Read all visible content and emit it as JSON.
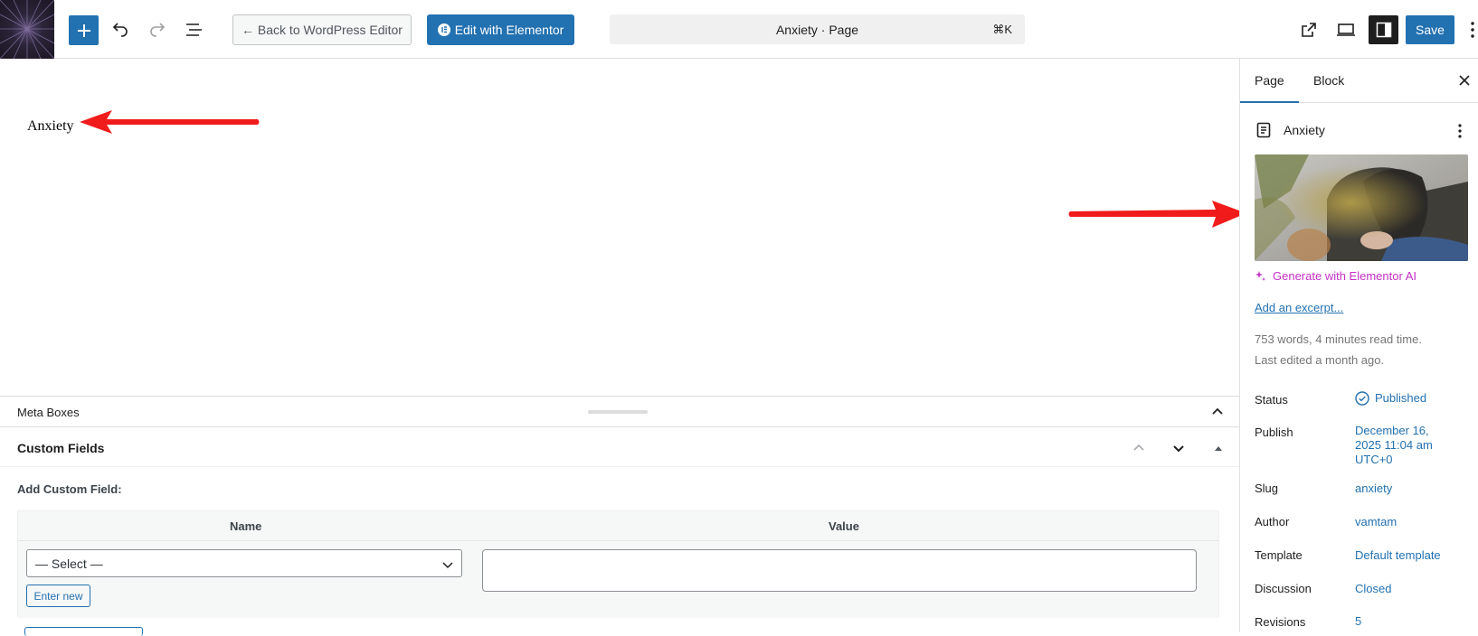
{
  "toolbar": {
    "back_label": "← Back to WordPress Editor",
    "elementor_label": "Edit with Elementor",
    "command_title": "Anxiety · Page",
    "command_shortcut": "⌘K",
    "save_label": "Save"
  },
  "canvas": {
    "page_title_text": "Anxiety"
  },
  "meta_boxes": {
    "label": "Meta Boxes",
    "custom_fields": {
      "title": "Custom Fields",
      "add_label": "Add Custom Field:",
      "col_name": "Name",
      "col_value": "Value",
      "select_value": "— Select —",
      "enter_new_label": "Enter new"
    }
  },
  "sidebar": {
    "tabs": [
      {
        "label": "Page",
        "active": true
      },
      {
        "label": "Block",
        "active": false
      }
    ],
    "document_title": "Anxiety",
    "generate_ai_label": "Generate with Elementor AI",
    "excerpt_link": "Add an excerpt...",
    "word_info": "753 words, 4 minutes read time.",
    "last_edited": "Last edited a month ago.",
    "properties": [
      {
        "label": "Status",
        "value": "Published"
      },
      {
        "label": "Publish",
        "value": "December 16, 2025 11:04 am UTC+0"
      },
      {
        "label": "Slug",
        "value": "anxiety"
      },
      {
        "label": "Author",
        "value": "vamtam"
      },
      {
        "label": "Template",
        "value": "Default template"
      },
      {
        "label": "Discussion",
        "value": "Closed"
      },
      {
        "label": "Revisions",
        "value": "5"
      }
    ]
  },
  "colors": {
    "accent": "#2271b1",
    "ai_magenta": "#c32fc4",
    "annotation_arrow": "#f01b1b"
  },
  "icons": [
    "site-logo-icon",
    "plus-icon",
    "undo-icon",
    "redo-icon",
    "document-overview-icon",
    "arrow-left-icon",
    "elementor-icon",
    "external-link-icon",
    "desktop-preview-icon",
    "sidebar-toggle-icon",
    "more-vertical-icon",
    "chevron-up-icon",
    "chevron-down-icon",
    "caret-up-icon",
    "close-icon",
    "page-icon",
    "sparkle-icon",
    "published-check-icon"
  ]
}
